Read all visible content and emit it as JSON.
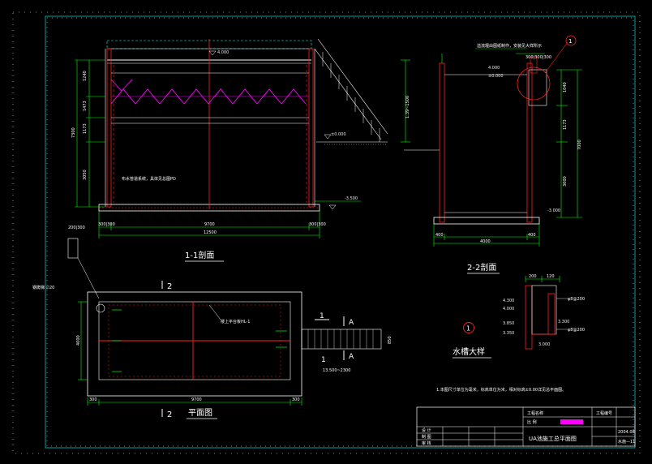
{
  "drawing": {
    "colors": {
      "background": "#000000",
      "border": "#00c8c8",
      "structure": "#ff2020",
      "dimension": "#00ff00",
      "baffle": "#ff00ff",
      "railing": "#ffffff",
      "walkway": "#00ffff",
      "yellow": "#ffff00"
    },
    "section_1_1": {
      "title": "1-1剖面",
      "level_top": "4.000",
      "level_ground": "±0.000",
      "level_bottom": "-3.500",
      "dim_total": "12500",
      "dim_inner": "9700",
      "dim_wall_left": "300|300",
      "dim_wall_right": "300|300",
      "left_dims": [
        "1240",
        "1473",
        "1173",
        "3050"
      ],
      "left_total": "7300",
      "right_dim": "1:39~1500",
      "note": "布水管道系统，具体见总图PD"
    },
    "section_2_2": {
      "title": "2-2剖面",
      "level_top": "4.000",
      "level_mid": "±0.000",
      "level_bottom": "-3.000",
      "note": "溢流堰由图纸制作，安装见大样所示",
      "callout": "1",
      "dim_bottom": "4000",
      "dim_left": "400",
      "dim_right": "400",
      "top_dims": "300|300|300",
      "right_dims": [
        "1040",
        "1173",
        "3000"
      ],
      "right_total": "7000"
    },
    "plan": {
      "title": "平面图",
      "section_mark_2_top": "2",
      "section_mark_2_bottom": "2",
      "section_mark_1_left": "1",
      "section_mark_1_right": "A",
      "section_mark_1b_left": "1",
      "section_mark_1b_right": "A",
      "rebar_note": "钢爬梯 ∅20",
      "stair_note": "楼上平台板HL-1",
      "stair_width": "850",
      "stair_length": "13.500~2300",
      "dim_bottom": "9700",
      "dim_left_wall": "300",
      "dim_right_wall": "300",
      "dim_side": "4000",
      "dim_top_left": "200|300",
      "rebar_dims": "200"
    },
    "detail": {
      "title": "水槽大样",
      "callout": "1",
      "top_dims": [
        "200",
        "120"
      ],
      "levels": [
        "4.300",
        "4.000",
        "3.850",
        "3.350",
        "3.000",
        "3.300"
      ],
      "labels": [
        "φ8@200",
        "φ8@200"
      ]
    },
    "notes": {
      "line1": "1.本图尺寸单位为毫米，标高单位为米，相对标高±0.00详见总平面图。"
    },
    "title_block": {
      "drawing_name": "UA池施工总平面图",
      "scale_label": "比 例",
      "date": "2004.08",
      "sheet_no": "水施—11",
      "rows": [
        "设 计",
        "制 图",
        "审 核"
      ],
      "project": "工程名称",
      "design_no": "工程编号"
    }
  }
}
